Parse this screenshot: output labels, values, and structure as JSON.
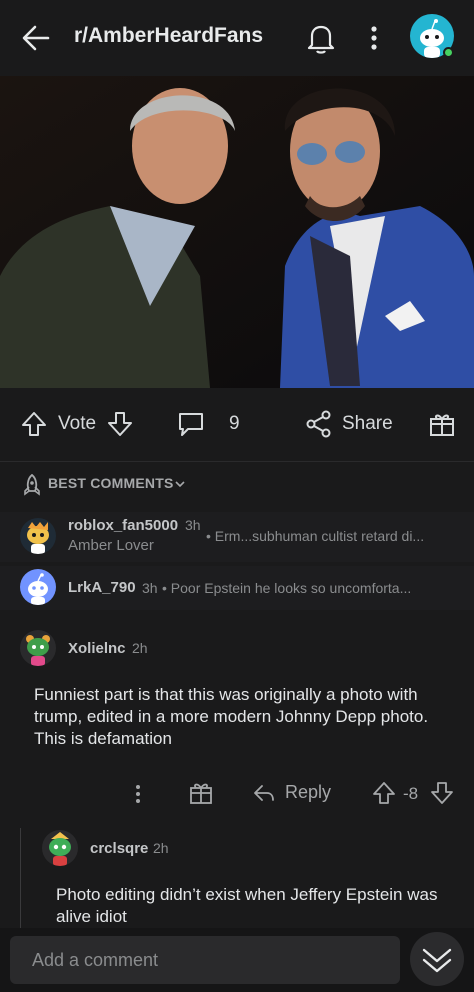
{
  "header": {
    "title": "r/AmberHeardFans",
    "icons": {
      "back": "back-arrow-icon",
      "notifications": "bell-icon",
      "more": "more-vertical-icon"
    }
  },
  "post_actions": {
    "vote_label": "Vote",
    "comment_count": "9",
    "share_label": "Share"
  },
  "sort": {
    "label": "BEST COMMENTS"
  },
  "collapsed_comments": [
    {
      "username": "roblox_fan5000",
      "age": "3h",
      "flair": "Amber Lover",
      "preview": "• Erm...subhuman cultist retard di..."
    },
    {
      "username": "LrkA_790",
      "age": "3h",
      "preview": "• Poor Epstein he looks so uncomforta..."
    }
  ],
  "comment": {
    "username": "Xolielnc",
    "age": "2h",
    "body": "Funniest part is that this was originally a photo with trump, edited in a more modern Johnny Depp photo. This is defamation",
    "reply_label": "Reply",
    "score": "-8"
  },
  "reply": {
    "username": "crclsqre",
    "age": "2h",
    "body": "Photo editing didn’t exist when Jeffery Epstein was alive idiot"
  },
  "composer": {
    "placeholder": "Add a comment"
  },
  "colors": {
    "background": "#1a1a1b",
    "online": "#46d160",
    "avatar_top": "#24b5d1"
  }
}
